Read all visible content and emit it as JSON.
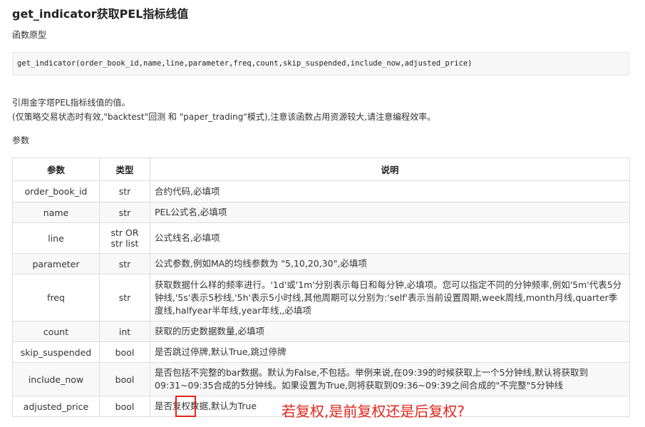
{
  "title": "get_indicator获取PEL指标线值",
  "subtitle": "函数原型",
  "code": "get_indicator(order_book_id,name,line,parameter,freq,count,skip_suspended,include_now,adjusted_price)",
  "desc1": "引用金字塔PEL指标线值的值。",
  "desc2": "(仅策略交易状态时有效,\"backtest\"回测 和 \"paper_trading\"模式),注意该函数占用资源较大,请注意编程效率。",
  "params_label": "参数",
  "table": {
    "headers": [
      "参数",
      "类型",
      "说明"
    ],
    "rows": [
      {
        "param": "order_book_id",
        "type": "str",
        "desc": "合约代码,必填项"
      },
      {
        "param": "name",
        "type": "str",
        "desc": "PEL公式名,必填项"
      },
      {
        "param": "line",
        "type": "str OR",
        "type2": "str list",
        "desc": "公式线名,必填项"
      },
      {
        "param": "parameter",
        "type": "str",
        "desc": "公式参数,例如MA的均线参数为 \"5,10,20,30\",必填项"
      },
      {
        "param": "freq",
        "type": "str",
        "desc": "获取数据什么样的频率进行。'1d'或'1m'分别表示每日和每分钟,必填项。您可以指定不同的分钟频率,例如'5m'代表5分钟线,'5s'表示5秒线,'5h'表示5小时线,其他周期可以分别为:'self'表示当前设置周期,week周线,month月线,quarter季度线,halfyear半年线,year年线,,必填项"
      },
      {
        "param": "count",
        "type": "int",
        "desc": "获取的历史数据数量,必填项"
      },
      {
        "param": "skip_suspended",
        "type": "bool",
        "desc": "是否跳过停牌,默认True,跳过停牌"
      },
      {
        "param": "include_now",
        "type": "bool",
        "desc": "是否包括不完整的bar数据。默认为False,不包括。举例来说,在09:39的时候获取上一个5分钟线,默认将获取到09:31~09:35合成的5分钟线。如果设置为True,则将获取到09:36~09:39之间合成的\"不完整\"5分钟线"
      },
      {
        "param": "adjusted_price",
        "type": "bool",
        "desc": "是否复权数据,默认为True"
      }
    ]
  },
  "annotation": "若复权,是前复权还是后复权?",
  "colors": {
    "annotation": "#e0261c"
  }
}
